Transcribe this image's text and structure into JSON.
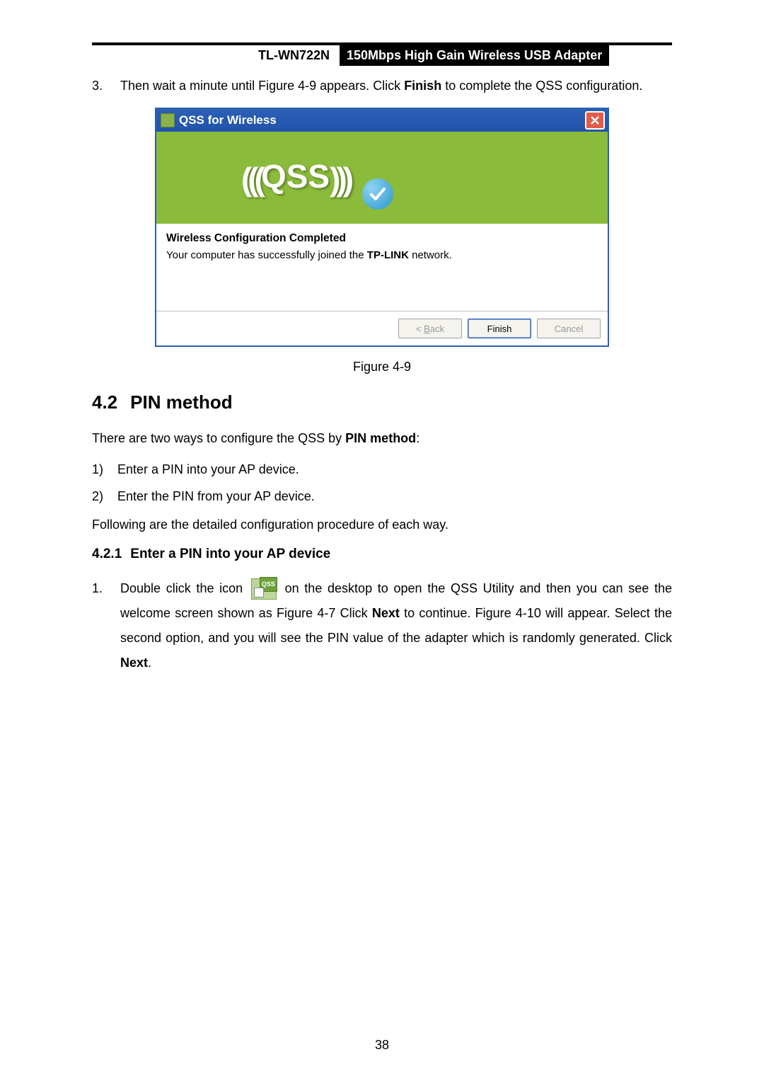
{
  "header": {
    "model": "TL-WN722N",
    "desc": "150Mbps High Gain Wireless USB Adapter"
  },
  "step3": {
    "num": "3.",
    "text_before": "Then wait a minute until Figure 4-9 appears. Click ",
    "bold1": "Finish",
    "text_after": " to complete the QSS configuration."
  },
  "dialog": {
    "title": "QSS for Wireless",
    "logo": "QSS",
    "heading": "Wireless Configuration Completed",
    "body_before": "Your computer has successfully joined the ",
    "body_bold": "TP-LINK",
    "body_after": " network.",
    "btn_back": "< Back",
    "btn_back_underline_char": "B",
    "btn_finish": "Finish",
    "btn_cancel": "Cancel"
  },
  "fig_caption": "Figure 4-9",
  "section": {
    "num": "4.2",
    "title": "PIN method"
  },
  "intro": {
    "before": "There are two ways to configure the QSS by ",
    "bold": "PIN method",
    "after": ":"
  },
  "list": {
    "i1_num": "1)",
    "i1_text": "Enter a PIN into your AP device.",
    "i2_num": "2)",
    "i2_text": "Enter the PIN from your AP device."
  },
  "follow": "Following are the detailed configuration procedure of each way.",
  "subsection": {
    "num": "4.2.1",
    "title": "Enter a PIN into your AP device"
  },
  "numstep": {
    "n": "1.",
    "t1": "Double click the icon ",
    "icon_badge": "QSS",
    "t2": " on the desktop to open the QSS Utility and then you can see the welcome screen shown as Figure 4-7 Click ",
    "b1": "Next",
    "t3": " to continue. Figure 4-10 will appear. Select the second option, and you will see the PIN value of the adapter which is randomly generated. Click ",
    "b2": "Next",
    "t4": "."
  },
  "page_number": "38"
}
